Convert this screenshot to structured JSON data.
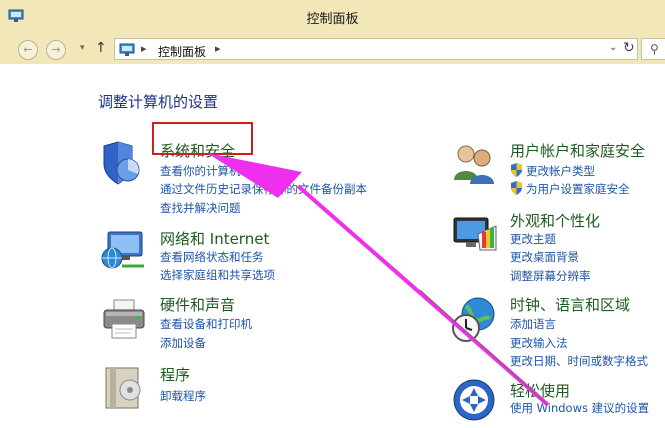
{
  "window": {
    "title": "控制面板",
    "icon": "control-panel-icon"
  },
  "nav": {
    "back_icon": "back-arrow-icon",
    "forward_icon": "forward-arrow-icon",
    "up_icon": "up-arrow-icon",
    "breadcrumb": "控制面板",
    "refresh_icon": "refresh-icon",
    "search_icon": "search-icon"
  },
  "main": {
    "heading": "调整计算机的设置",
    "categories": [
      {
        "title": "系统和安全",
        "icon": "shield-icon",
        "links": [
          "查看你的计算机状态",
          "通过文件历史记录保存你的文件备份副本",
          "查找并解决问题"
        ]
      },
      {
        "title": "网络和 Internet",
        "icon": "network-globe-icon",
        "links": [
          "查看网络状态和任务",
          "选择家庭组和共享选项"
        ]
      },
      {
        "title": "硬件和声音",
        "icon": "printer-icon",
        "links": [
          "查看设备和打印机",
          "添加设备"
        ]
      },
      {
        "title": "程序",
        "icon": "programs-box-icon",
        "links": [
          "卸载程序"
        ]
      },
      {
        "title": "用户帐户和家庭安全",
        "icon": "users-icon",
        "links": [
          "更改帐户类型",
          "为用户设置家庭安全"
        ]
      },
      {
        "title": "外观和个性化",
        "icon": "monitor-palette-icon",
        "links": [
          "更改主题",
          "更改桌面背景",
          "调整屏幕分辨率"
        ]
      },
      {
        "title": "时钟、语言和区域",
        "icon": "globe-clock-icon",
        "links": [
          "添加语言",
          "更改输入法",
          "更改日期、时间或数字格式"
        ]
      },
      {
        "title": "轻松使用",
        "icon": "ease-of-access-icon",
        "links": [
          "使用 Windows 建议的设置"
        ]
      }
    ]
  },
  "annotation": {
    "highlight_color": "#cc1f1f",
    "arrow_color": "#ee30ee"
  }
}
